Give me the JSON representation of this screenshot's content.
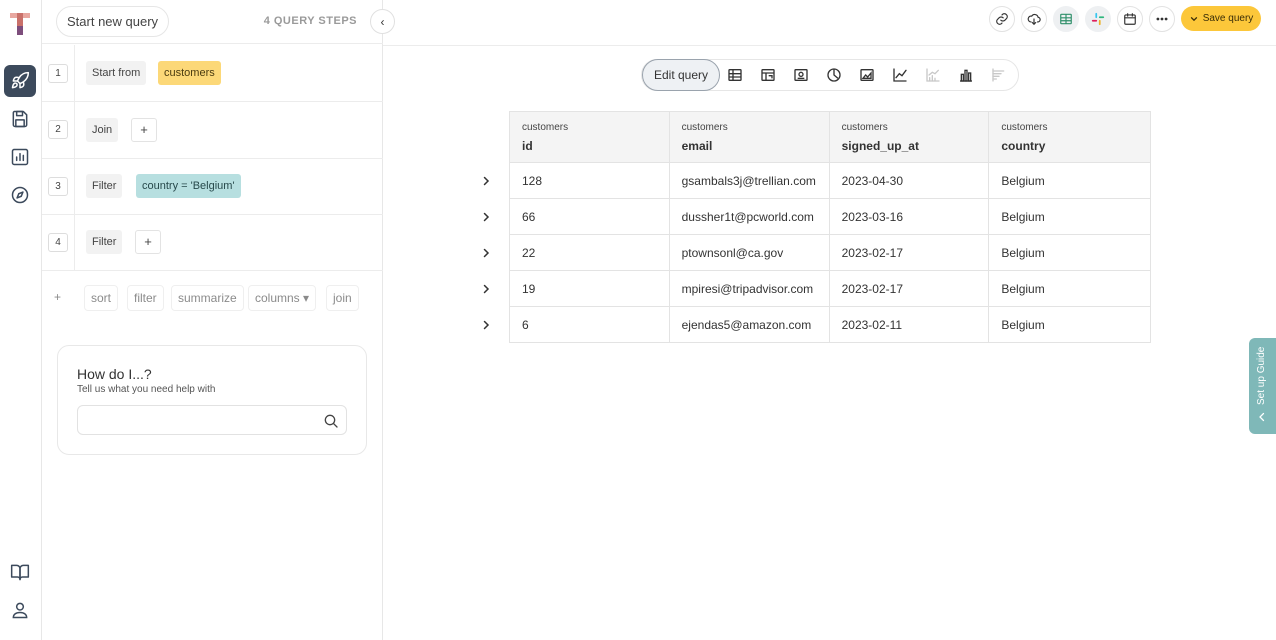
{
  "panel": {
    "new_query_label": "Start new query",
    "steps_count": "4 QUERY STEPS",
    "steps": [
      {
        "num": "1",
        "action": "Start from",
        "value": "customers"
      },
      {
        "num": "2",
        "action": "Join",
        "value": "+"
      },
      {
        "num": "3",
        "action": "Filter",
        "value": "country = 'Belgium'"
      },
      {
        "num": "4",
        "action": "Filter",
        "value": "+"
      }
    ],
    "add_actions": {
      "plus": "+",
      "sort": "sort",
      "filter": "filter",
      "summarize": "summarize",
      "columns": "columns ▾",
      "join": "join"
    },
    "help": {
      "title": "How do I...?",
      "subtitle": "Tell us what you need help with",
      "placeholder": ""
    }
  },
  "toolbar": {
    "save_label": "Save query",
    "edit_query_label": "Edit query"
  },
  "table": {
    "columns": [
      {
        "table": "customers",
        "name": "id"
      },
      {
        "table": "customers",
        "name": "email"
      },
      {
        "table": "customers",
        "name": "signed_up_at"
      },
      {
        "table": "customers",
        "name": "country"
      }
    ],
    "rows": [
      [
        "128",
        "gsambals3j@trellian.com",
        "2023-04-30",
        "Belgium"
      ],
      [
        "66",
        "dussher1t@pcworld.com",
        "2023-03-16",
        "Belgium"
      ],
      [
        "22",
        "ptownsonl@ca.gov",
        "2023-02-17",
        "Belgium"
      ],
      [
        "19",
        "mpiresi@tripadvisor.com",
        "2023-02-17",
        "Belgium"
      ],
      [
        "6",
        "ejendas5@amazon.com",
        "2023-02-11",
        "Belgium"
      ]
    ]
  },
  "guide": {
    "label": "Set up Guide"
  },
  "icons": {
    "rail": [
      "rocket-icon",
      "save-icon",
      "report-icon",
      "compass-icon",
      "book-icon",
      "user-icon"
    ],
    "toolbar": [
      "link-icon",
      "cloud-download-icon",
      "table-icon",
      "slack-icon",
      "calendar-icon",
      "more-icon"
    ],
    "views": [
      "table-view-icon",
      "pivot-view-icon",
      "number-view-icon",
      "pie-view-icon",
      "area-view-icon",
      "line-view-icon",
      "combo-view-icon",
      "bar-view-icon",
      "row-view-icon"
    ]
  },
  "colors": {
    "accent": "#fcc73a",
    "rail_active": "#3c4a5c",
    "chip_yellow": "#fcd878",
    "chip_teal": "#b7dfe0",
    "guide": "#7fb8b8"
  }
}
